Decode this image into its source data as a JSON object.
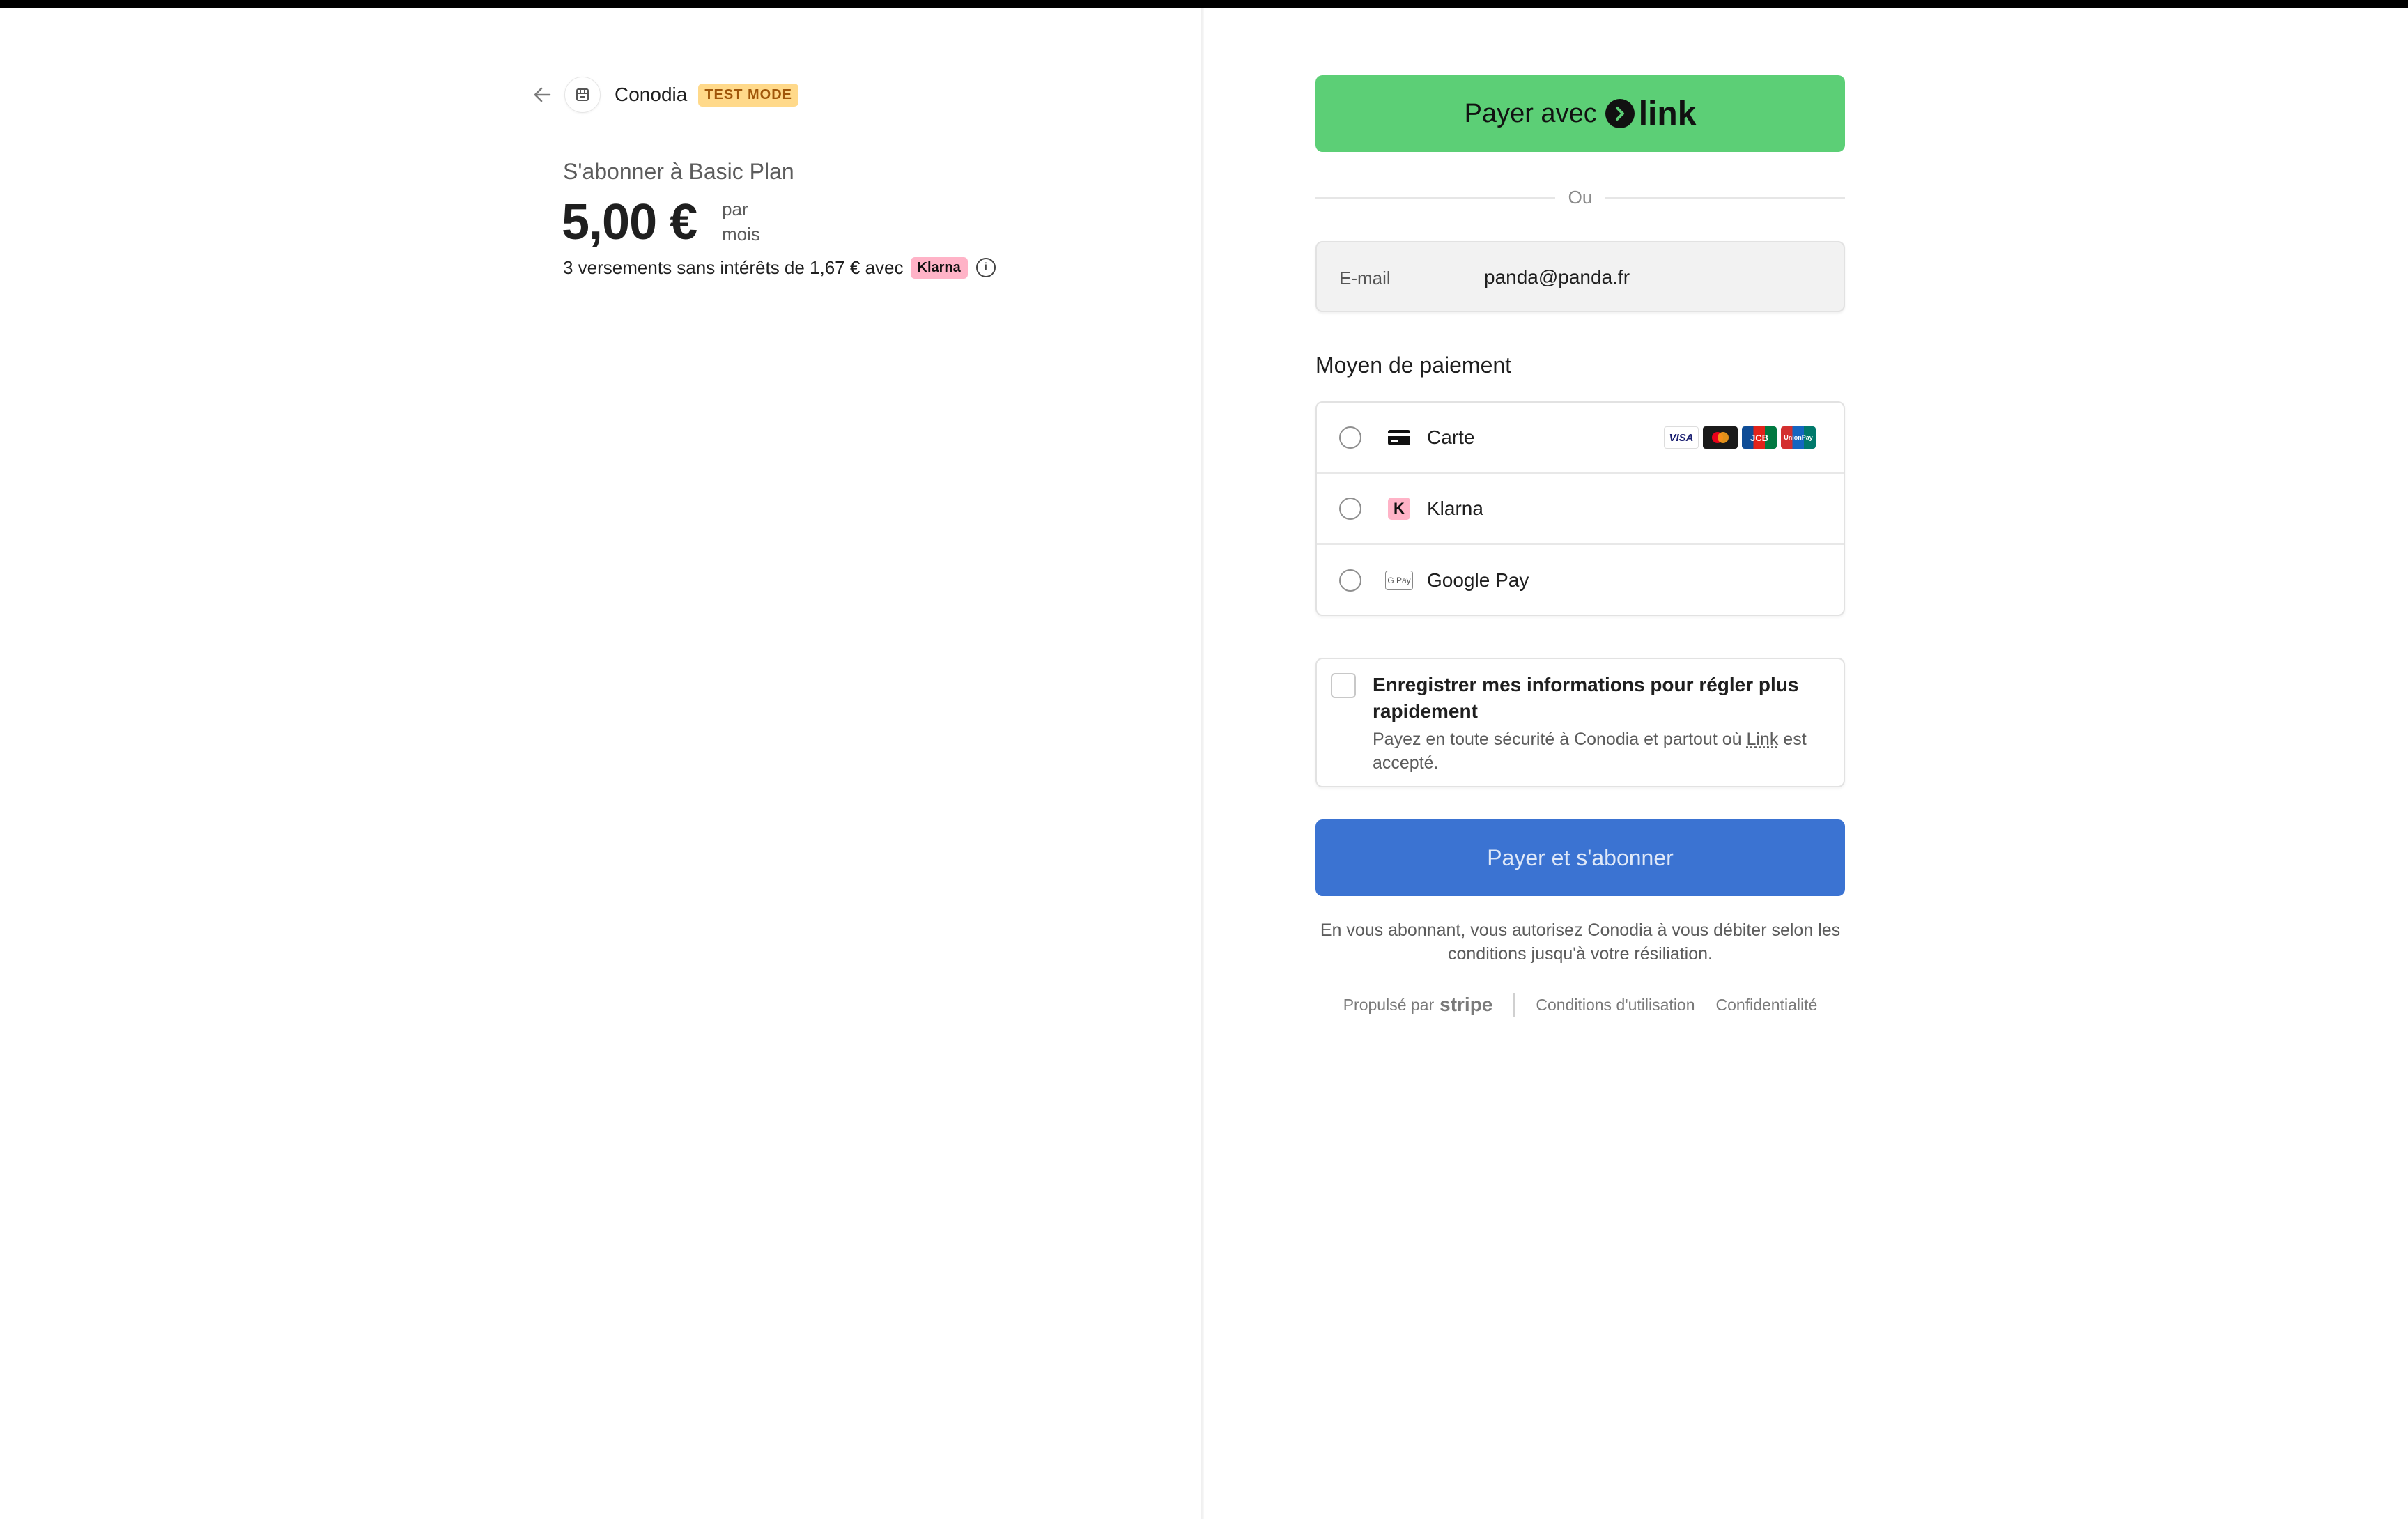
{
  "header": {
    "merchant_name": "Conodia",
    "test_badge": "TEST MODE"
  },
  "summary": {
    "subscribe_label": "S'abonner à Basic Plan",
    "price": "5,00 €",
    "period_line1": "par",
    "period_line2": "mois",
    "installments_text": "3 versements sans intérêts de 1,67 € avec",
    "klarna_badge": "Klarna"
  },
  "link_button": {
    "prefix": "Payer avec",
    "brand": "link",
    "color": "#5ccf76"
  },
  "divider_text": "Ou",
  "email": {
    "label": "E-mail",
    "value": "panda@panda.fr"
  },
  "payment_method": {
    "title": "Moyen de paiement",
    "options": [
      {
        "label": "Carte",
        "icon": "card-icon"
      },
      {
        "label": "Klarna",
        "icon": "klarna-icon"
      },
      {
        "label": "Google Pay",
        "icon": "google-pay-icon"
      }
    ],
    "card_brands": [
      "VISA",
      "mastercard",
      "JCB",
      "UnionPay"
    ]
  },
  "save_info": {
    "title": "Enregistrer mes informations pour régler plus rapidement",
    "desc_before": "Payez en toute sécurité à Conodia et partout où ",
    "desc_link": "Link",
    "desc_after": " est accepté."
  },
  "pay_button": {
    "label": "Payer et s'abonner",
    "color": "#3b73d2"
  },
  "terms_text": "En vous abonnant, vous autorisez Conodia à vous débiter selon les conditions jusqu'à votre résiliation.",
  "footer": {
    "powered_by": "Propulsé par",
    "brand": "stripe",
    "terms_link": "Conditions d'utilisation",
    "privacy_link": "Confidentialité"
  }
}
